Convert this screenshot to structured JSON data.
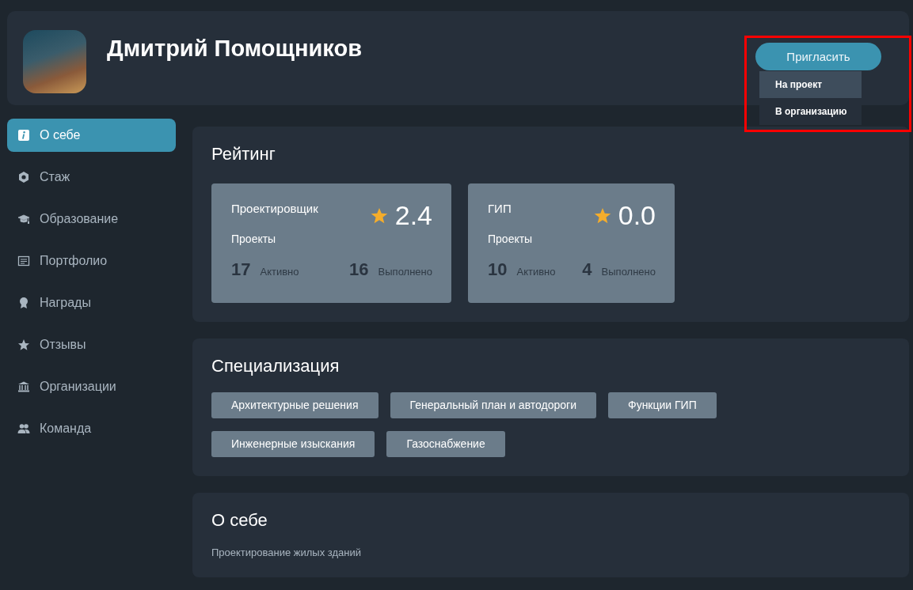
{
  "profile": {
    "name": "Дмитрий Помощников"
  },
  "invite": {
    "label": "Пригласить",
    "menu": [
      {
        "label": "На проект",
        "selected": true
      },
      {
        "label": "В организацию",
        "selected": false
      }
    ]
  },
  "sidebar": {
    "items": [
      {
        "label": "О себе",
        "selected": true
      },
      {
        "label": "Стаж",
        "selected": false
      },
      {
        "label": "Образование",
        "selected": false
      },
      {
        "label": "Портфолио",
        "selected": false
      },
      {
        "label": "Награды",
        "selected": false
      },
      {
        "label": "Отзывы",
        "selected": false
      },
      {
        "label": "Организации",
        "selected": false
      },
      {
        "label": "Команда",
        "selected": false
      }
    ]
  },
  "rating": {
    "title": "Рейтинг",
    "cards": [
      {
        "role": "Проектировщик",
        "score": "2.4",
        "projects_label": "Проекты",
        "active": "17",
        "active_label": "Активно",
        "done": "16",
        "done_label": "Выполнено"
      },
      {
        "role": "ГИП",
        "score": "0.0",
        "projects_label": "Проекты",
        "active": "10",
        "active_label": "Активно",
        "done": "4",
        "done_label": "Выполнено"
      }
    ]
  },
  "specialization": {
    "title": "Специализация",
    "tags": [
      [
        "Архитектурные решения",
        "Генеральный план и автодороги",
        "Функции ГИП"
      ],
      [
        "Инженерные изыскания",
        "Газоснабжение"
      ]
    ]
  },
  "about": {
    "title": "О себе",
    "text": "Проектирование жилых зданий"
  }
}
